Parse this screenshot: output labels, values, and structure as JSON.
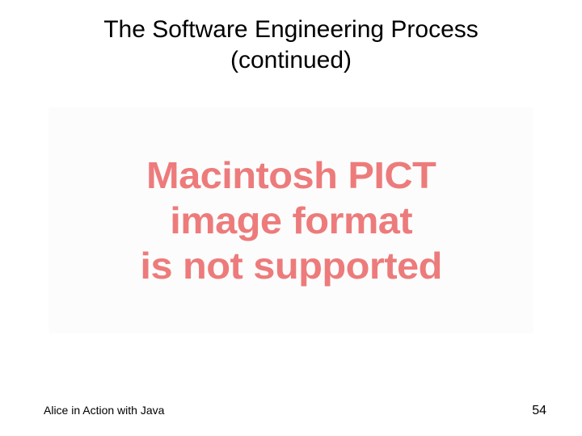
{
  "title_line1": "The Software Engineering Process",
  "title_line2": "(continued)",
  "error_line1": "Macintosh PICT",
  "error_line2": "image format",
  "error_line3": "is not supported",
  "footer": {
    "left": "Alice in Action with Java",
    "page_number": "54"
  }
}
